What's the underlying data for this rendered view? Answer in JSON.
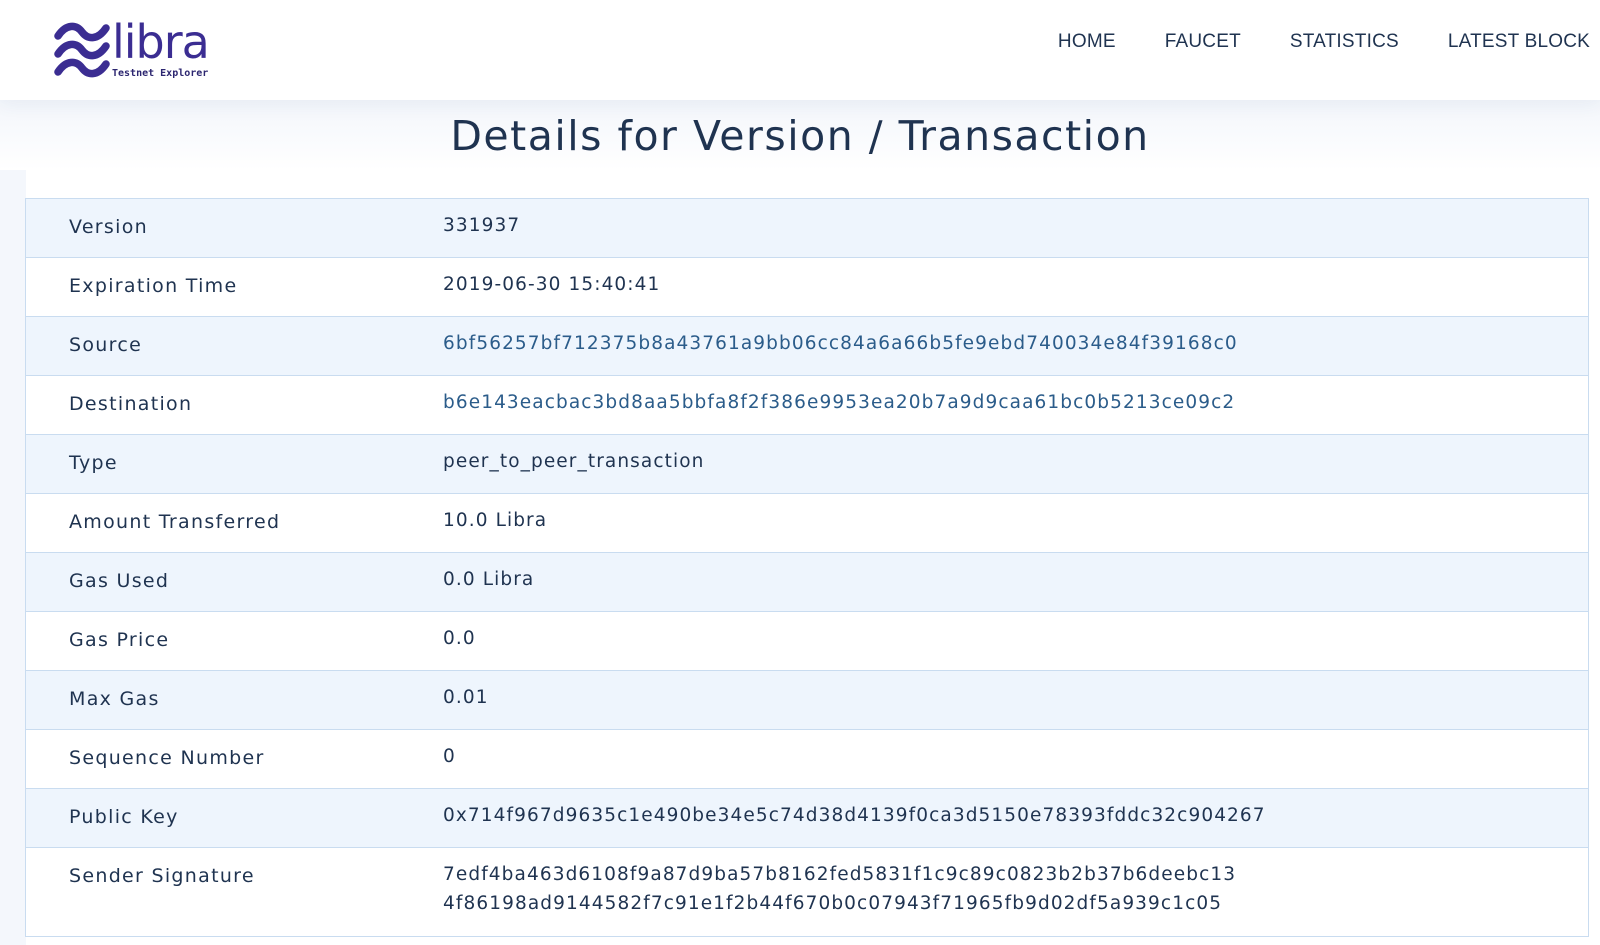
{
  "brand": {
    "name": "libra",
    "subtitle": "Testnet Explorer",
    "color": "#3b2d92"
  },
  "nav": {
    "items": [
      "HOME",
      "FAUCET",
      "STATISTICS",
      "LATEST BLOCK"
    ]
  },
  "page": {
    "title": "Details for Version / Transaction"
  },
  "details": [
    {
      "label": "Version",
      "value": "331937"
    },
    {
      "label": "Expiration Time",
      "value": "2019-06-30 15:40:41"
    },
    {
      "label": "Source",
      "value": "6bf56257bf712375b8a43761a9bb06cc84a6a66b5fe9ebd740034e84f39168c0"
    },
    {
      "label": "Destination",
      "value": "b6e143eacbac3bd8aa5bbfa8f2f386e9953ea20b7a9d9caa61bc0b5213ce09c2"
    },
    {
      "label": "Type",
      "value": "peer_to_peer_transaction"
    },
    {
      "label": "Amount Transferred",
      "value": "10.0 Libra"
    },
    {
      "label": "Gas Used",
      "value": "0.0 Libra"
    },
    {
      "label": "Gas Price",
      "value": "0.0"
    },
    {
      "label": "Max Gas",
      "value": "0.01"
    },
    {
      "label": "Sequence Number",
      "value": "0"
    },
    {
      "label": "Public Key",
      "value": "0x714f967d9635c1e490be34e5c74d38d4139f0ca3d5150e78393fddc32c904267"
    },
    {
      "label": "Sender Signature",
      "value_lines": [
        "7edf4ba463d6108f9a87d9ba57b8162fed5831f1c9c89c0823b2b37b6deebc13",
        "4f86198ad9144582f7c91e1f2b44f670b0c07943f71965fb9d02df5a939c1c05"
      ]
    }
  ]
}
